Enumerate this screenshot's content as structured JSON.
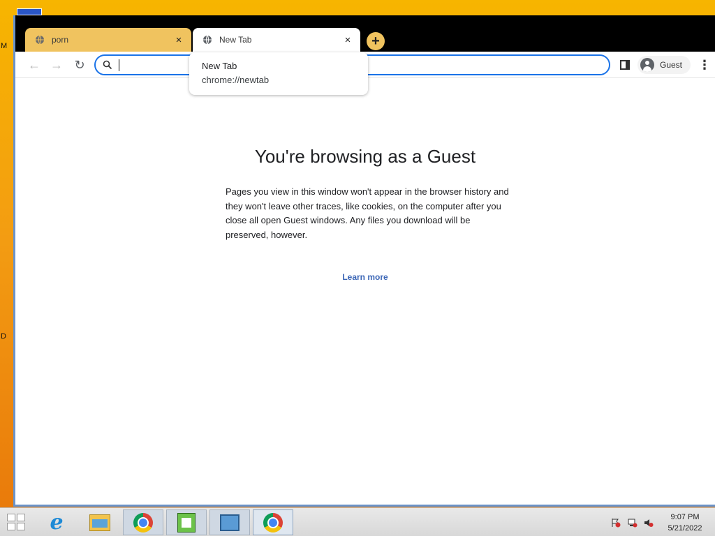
{
  "desktop": {
    "edge_letters": [
      "M",
      "D"
    ]
  },
  "browser": {
    "tabs": [
      {
        "title": "porn",
        "close_glyph": "×",
        "state": "inactive"
      },
      {
        "title": "New Tab",
        "close_glyph": "×",
        "state": "active"
      }
    ],
    "new_tab_glyph": "+",
    "toolbar": {
      "back_glyph": "←",
      "forward_glyph": "→",
      "reload_glyph": "↻",
      "omnibox_value": "",
      "profile_label": "Guest",
      "menu_glyph": "⋮"
    },
    "hover_card": {
      "title": "New Tab",
      "url": "chrome://newtab"
    },
    "page": {
      "heading": "You're browsing as a Guest",
      "description": "Pages you view in this window won't appear in the browser history and they won't leave other traces, like cookies, on the computer after you close all open Guest windows. Any files you download will be preserved, however.",
      "learn_more": "Learn more"
    }
  },
  "taskbar": {
    "pinned_icons": [
      "start-icon",
      "internet-explorer-icon",
      "file-explorer-icon",
      "chrome-icon",
      "notepad-plus-plus-icon",
      "remote-desktop-icon",
      "chrome-icon"
    ],
    "clock_time": "9:07 PM",
    "clock_date": "5/21/2022"
  },
  "colors": {
    "accent_blue": "#1a73e8",
    "tab_inactive": "#f0c35f",
    "link": "#3b66b6",
    "wallpaper": "#f39c12"
  }
}
